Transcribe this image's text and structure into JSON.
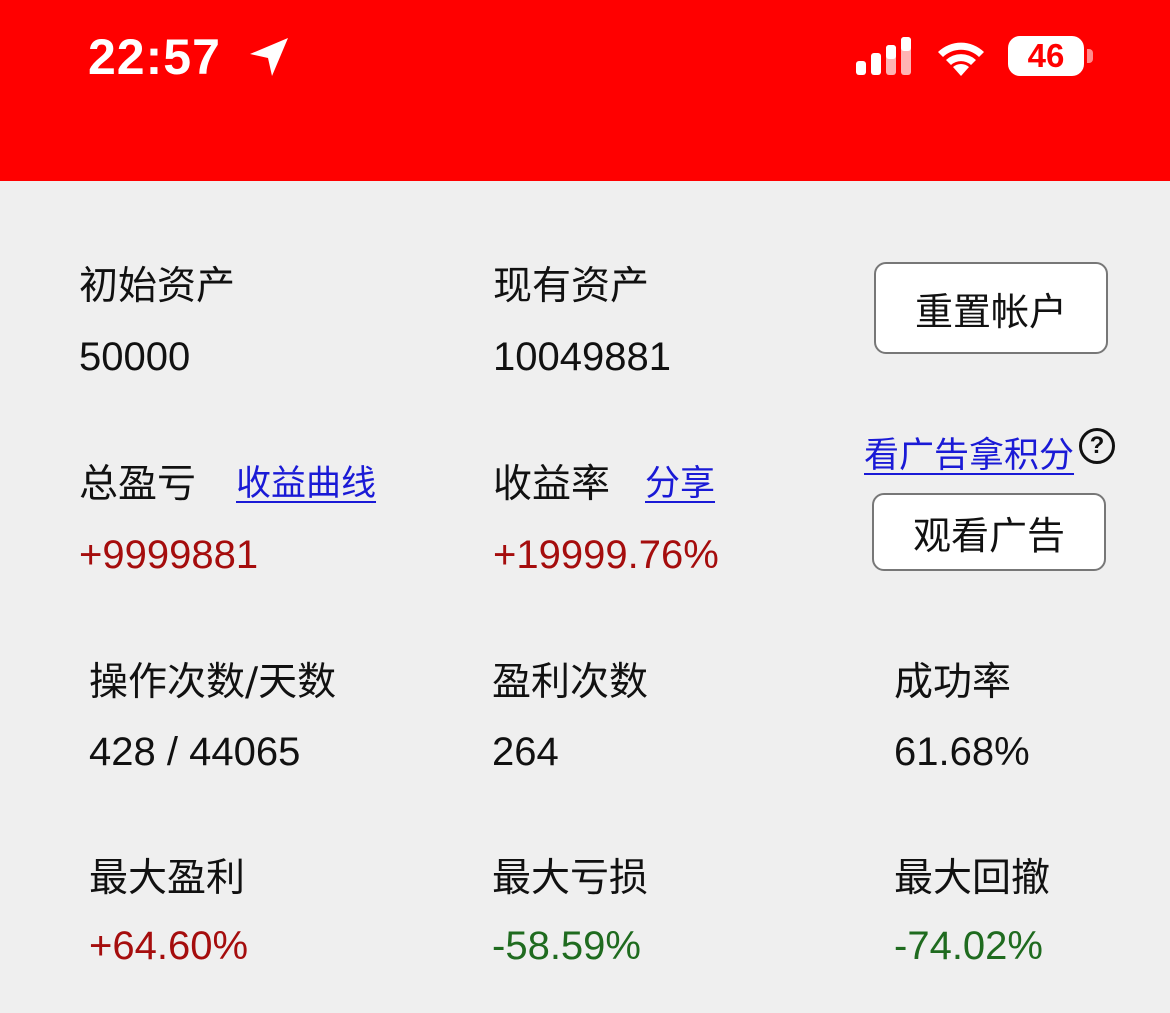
{
  "status_bar": {
    "time": "22:57",
    "battery": "46",
    "icons": [
      "location-arrow-icon",
      "signal-icon",
      "wifi-icon",
      "battery-icon"
    ],
    "background_color": "#ff0000"
  },
  "stats": {
    "initial_assets": {
      "label": "初始资产",
      "value": "50000"
    },
    "current_assets": {
      "label": "现有资产",
      "value": "10049881"
    },
    "total_pnl": {
      "label": "总盈亏",
      "link": "收益曲线",
      "value": "+9999881"
    },
    "return_rate": {
      "label": "收益率",
      "link": "分享",
      "value": "+19999.76%"
    },
    "ops_days": {
      "label": "操作次数/天数",
      "value": "428 / 44065"
    },
    "profit_count": {
      "label": "盈利次数",
      "value": "264"
    },
    "success_rate": {
      "label": "成功率",
      "value": "61.68%"
    },
    "max_profit": {
      "label": "最大盈利",
      "value": "+64.60%"
    },
    "max_loss": {
      "label": "最大亏损",
      "value": "-58.59%"
    },
    "max_drawdown": {
      "label": "最大回撤",
      "value": "-74.02%"
    }
  },
  "actions": {
    "reset_account": "重置帐户",
    "ad_points_link": "看广告拿积分",
    "help_symbol": "?",
    "watch_ad": "观看广告"
  },
  "colors": {
    "positive": "#a50d0d",
    "negative": "#1f6b1f",
    "link": "#1a1ad6"
  }
}
